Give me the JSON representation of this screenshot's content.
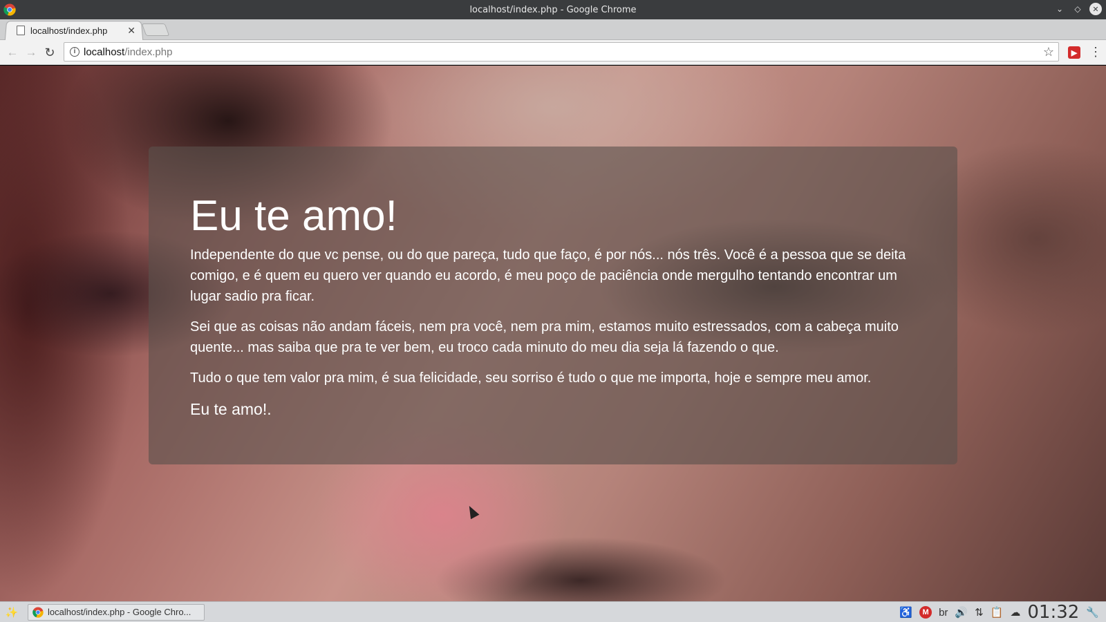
{
  "window": {
    "title": "localhost/index.php - Google Chrome"
  },
  "tabs": [
    {
      "label": "localhost/index.php"
    }
  ],
  "omnibox": {
    "host": "localhost",
    "path": "/index.php"
  },
  "page": {
    "heading": "Eu te amo!",
    "paragraphs": [
      "Independente do que vc pense, ou do que pareça, tudo que faço, é por nós... nós três. Você é a pessoa que se deita comigo, e é quem eu quero ver quando eu acordo, é meu poço de paciência onde mergulho tentando encontrar um lugar sadio pra ficar.",
      "Sei que as coisas não andam fáceis, nem pra você, nem pra mim, estamos muito estressados, com a cabeça muito quente... mas saiba que pra te ver bem, eu troco cada minuto do meu dia seja lá fazendo o que.",
      "Tudo o que tem valor pra mim, é sua felicidade, seu sorriso é tudo o que me importa, hoje e sempre meu amor."
    ],
    "closing": "Eu te amo!."
  },
  "taskbar": {
    "task_label": "localhost/index.php - Google Chro...",
    "keyboard_layout": "br",
    "clock": "01:32"
  },
  "colors": {
    "titlebar": "#3a3c3e",
    "panel_overlay": "rgba(90,80,76,0.62)",
    "extension_red": "#d32b2b"
  }
}
